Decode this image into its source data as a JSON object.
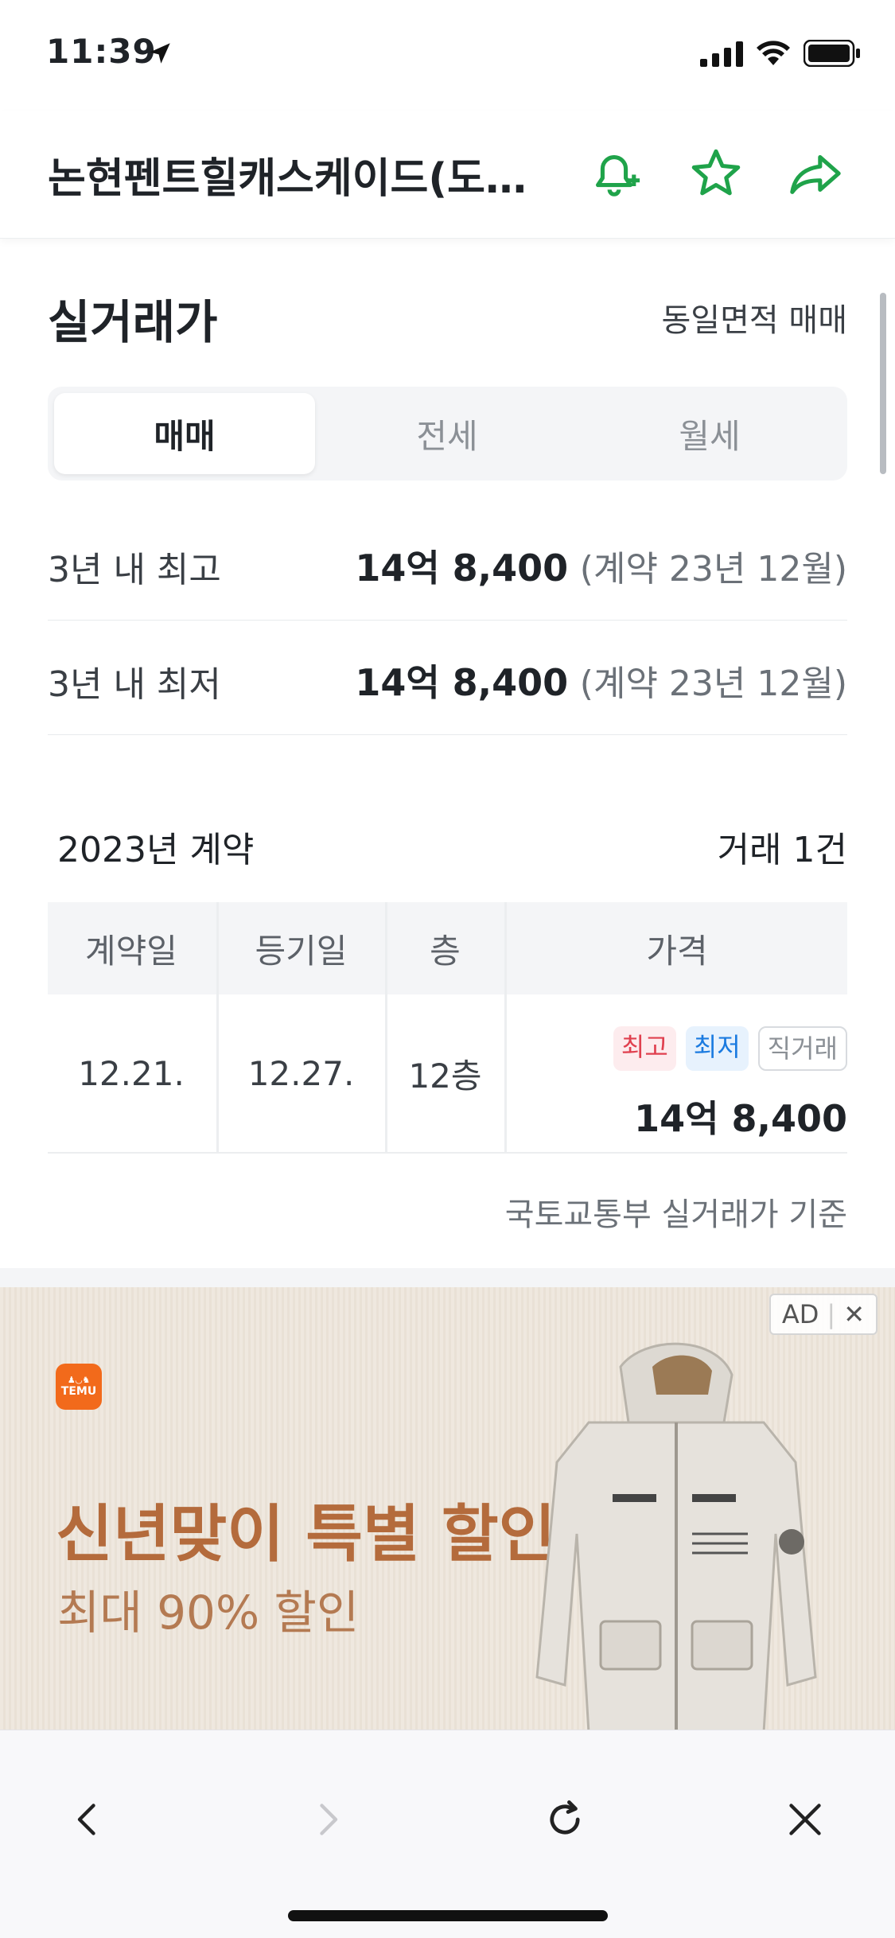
{
  "status_bar": {
    "time": "11:39"
  },
  "header": {
    "title": "논현펜트힐캐스케이드(도시..."
  },
  "section": {
    "title": "실거래가",
    "same_area_link": "동일면적 매매",
    "tabs": [
      "매매",
      "전세",
      "월세"
    ],
    "active_tab": "매매"
  },
  "stats": [
    {
      "label": "3년 내 최고",
      "value": "14억 8,400",
      "note": "(계약 23년 12월)"
    },
    {
      "label": "3년 내 최저",
      "value": "14억 8,400",
      "note": "(계약 23년 12월)"
    }
  ],
  "contracts": {
    "year_title": "2023년 계약",
    "count_label": "거래 1건",
    "columns": [
      "계약일",
      "등기일",
      "층",
      "가격"
    ],
    "rows": [
      {
        "contract_date": "12.21.",
        "registration_date": "12.27.",
        "floor": "12층",
        "badges": [
          "최고",
          "최저",
          "직거래"
        ],
        "price": "14억 8,400"
      }
    ],
    "source_note": "국토교통부 실거래가 기준"
  },
  "ad": {
    "tag": "AD",
    "close_glyph": "✕",
    "brand": "TEMU",
    "headline": "신년맞이 특별 할인",
    "subline": "최대 90% 할인",
    "colors": {
      "headline": "#b46b3c",
      "logo": "#f26a1b"
    }
  },
  "colors": {
    "accent": "#1fa34a",
    "badge_high": "#e0404f",
    "badge_low": "#1b7be0"
  }
}
